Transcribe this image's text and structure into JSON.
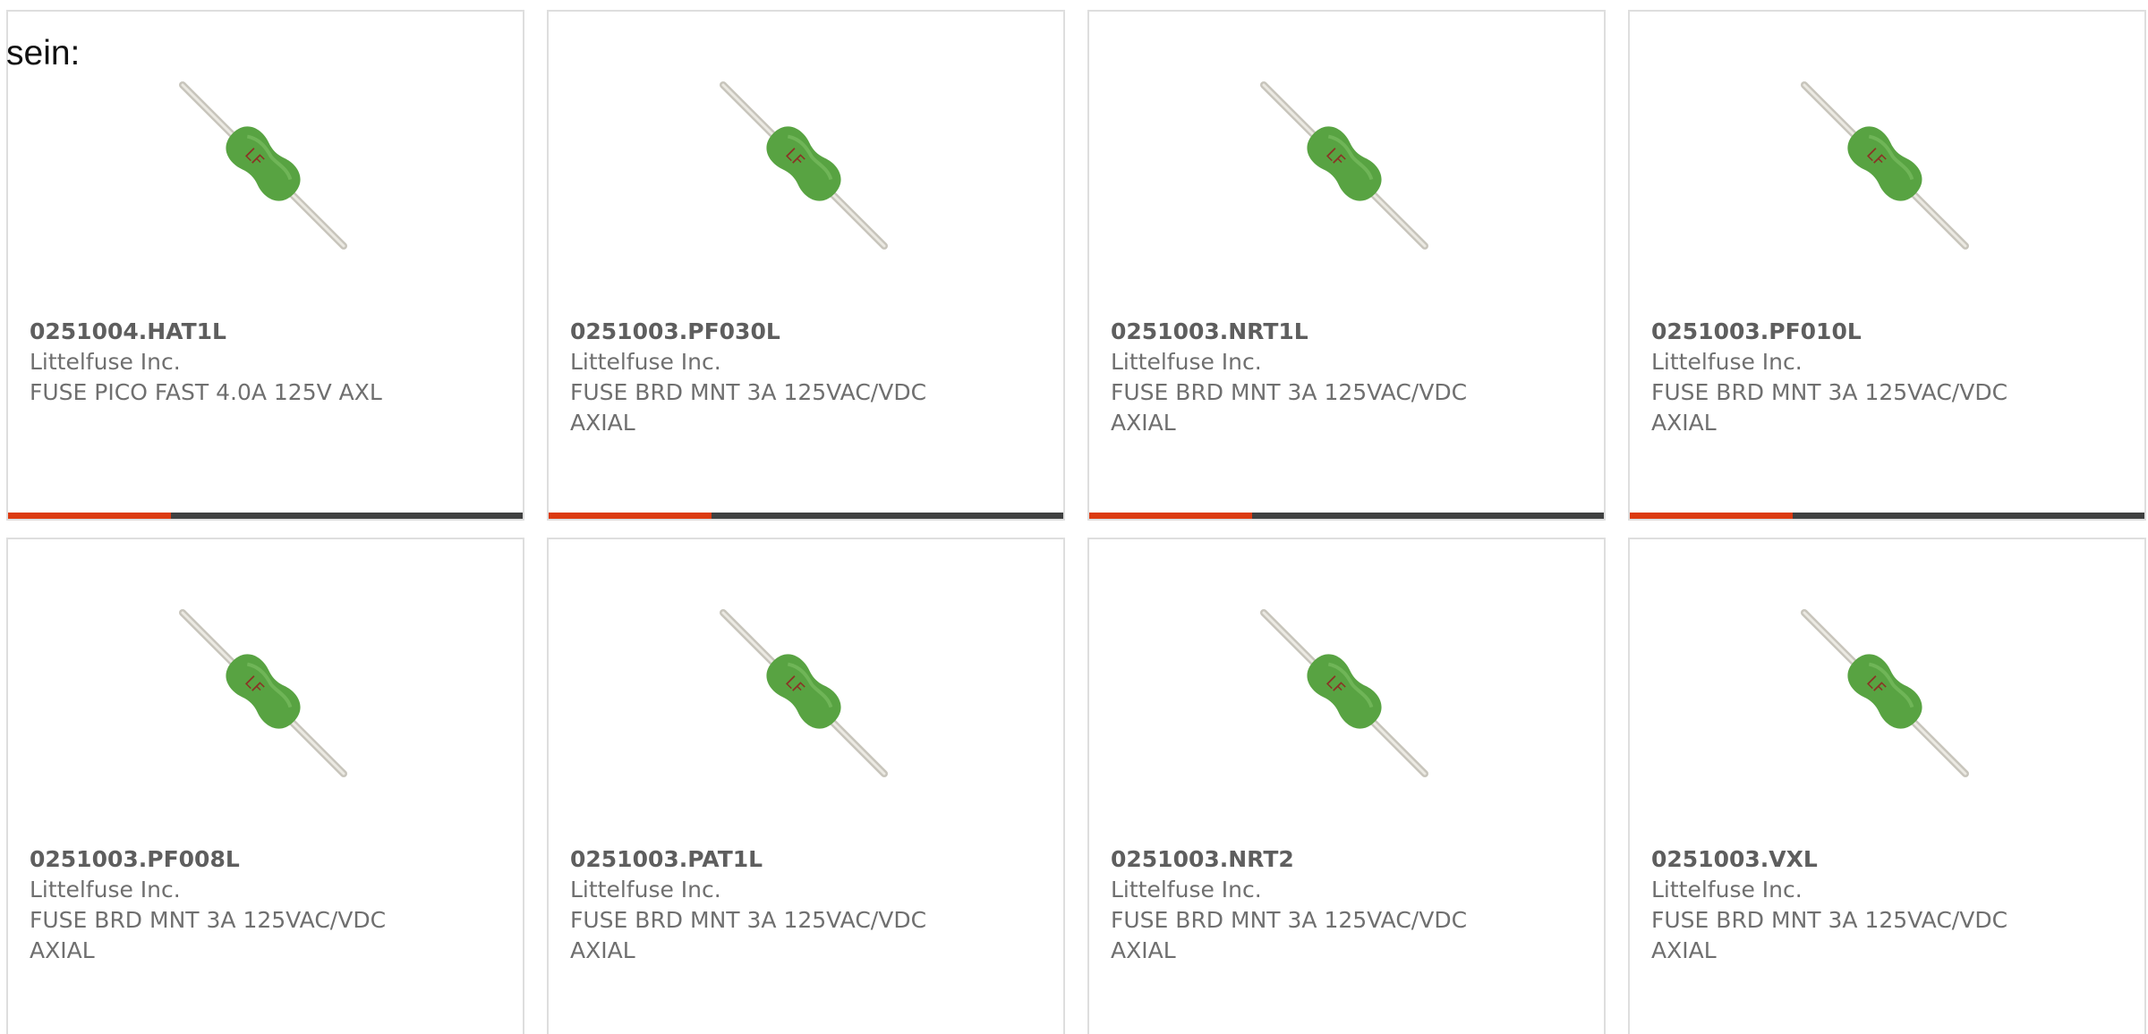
{
  "page": {
    "heading": "sein:"
  },
  "products": [
    {
      "part_number": "0251004.HAT1L",
      "manufacturer": "Littelfuse Inc.",
      "description": "FUSE PICO FAST 4.0A 125V AXL",
      "image_icon": "axial-fuse-icon"
    },
    {
      "part_number": "0251003.PF030L",
      "manufacturer": "Littelfuse Inc.",
      "description": "FUSE BRD MNT 3A 125VAC/VDC AXIAL",
      "image_icon": "axial-fuse-icon"
    },
    {
      "part_number": "0251003.NRT1L",
      "manufacturer": "Littelfuse Inc.",
      "description": "FUSE BRD MNT 3A 125VAC/VDC AXIAL",
      "image_icon": "axial-fuse-icon"
    },
    {
      "part_number": "0251003.PF010L",
      "manufacturer": "Littelfuse Inc.",
      "description": "FUSE BRD MNT 3A 125VAC/VDC AXIAL",
      "image_icon": "axial-fuse-icon"
    },
    {
      "part_number": "0251003.PF008L",
      "manufacturer": "Littelfuse Inc.",
      "description": "FUSE BRD MNT 3A 125VAC/VDC AXIAL",
      "image_icon": "axial-fuse-icon"
    },
    {
      "part_number": "0251003.PAT1L",
      "manufacturer": "Littelfuse Inc.",
      "description": "FUSE BRD MNT 3A 125VAC/VDC AXIAL",
      "image_icon": "axial-fuse-icon"
    },
    {
      "part_number": "0251003.NRT2",
      "manufacturer": "Littelfuse Inc.",
      "description": "FUSE BRD MNT 3A 125VAC/VDC AXIAL",
      "image_icon": "axial-fuse-icon"
    },
    {
      "part_number": "0251003.VXL",
      "manufacturer": "Littelfuse Inc.",
      "description": "FUSE BRD MNT 3A 125VAC/VDC AXIAL",
      "image_icon": "axial-fuse-icon"
    }
  ],
  "colors": {
    "card_border": "#dedede",
    "text": "#6f6f6f",
    "part_number": "#5e5e5e",
    "accent": "#dc3a10",
    "bar": "#3f4040",
    "fuse_body": "#58a342",
    "fuse_lead": "#c8c5bc"
  },
  "progress_bar": {
    "accent_fraction": 0.316
  }
}
